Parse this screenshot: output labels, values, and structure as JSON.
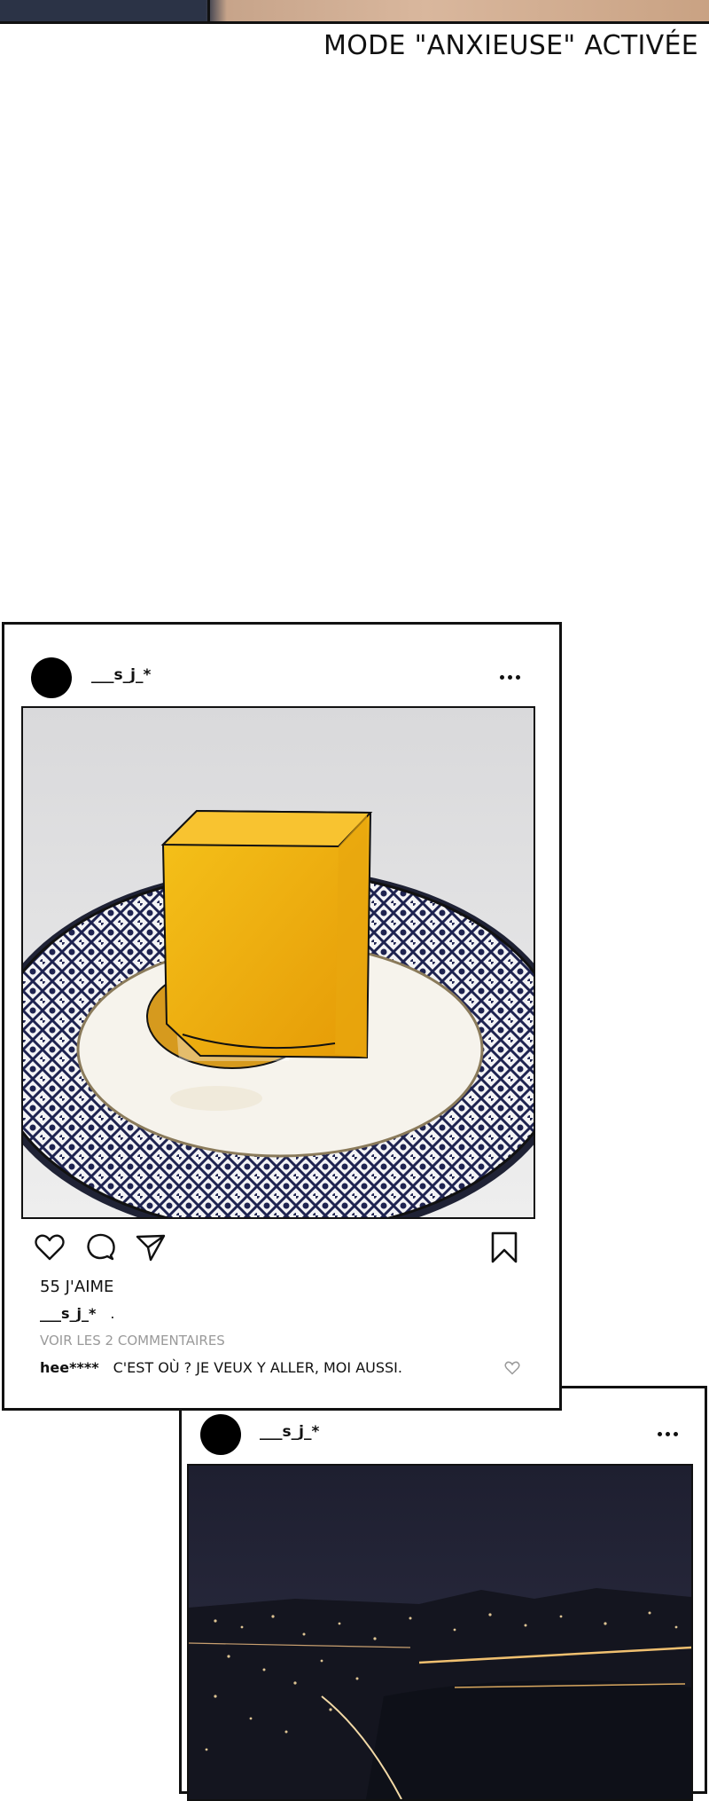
{
  "caption": "MODE \"ANXIEUSE\" ACTIVÉE",
  "post1": {
    "username": "___s_j_*",
    "photo_icon": "dessert-photo",
    "likes": "55 J'AIME",
    "caption_user": "___s_j_*",
    "caption_text": ".",
    "view_comments": "VOIR LES 2 COMMENTAIRES",
    "comment_user": "hee****",
    "comment_text": "C'EST OÙ ? JE VEUX Y ALLER, MOI AUSSI."
  },
  "post2": {
    "username": "___s_j_*",
    "photo_icon": "night-city-photo"
  },
  "colors": {
    "border": "#111111",
    "muted": "#9a9a9a",
    "cake": "#f2b20a",
    "plate_pattern": "#1e2350",
    "night_sky": "#252638"
  }
}
